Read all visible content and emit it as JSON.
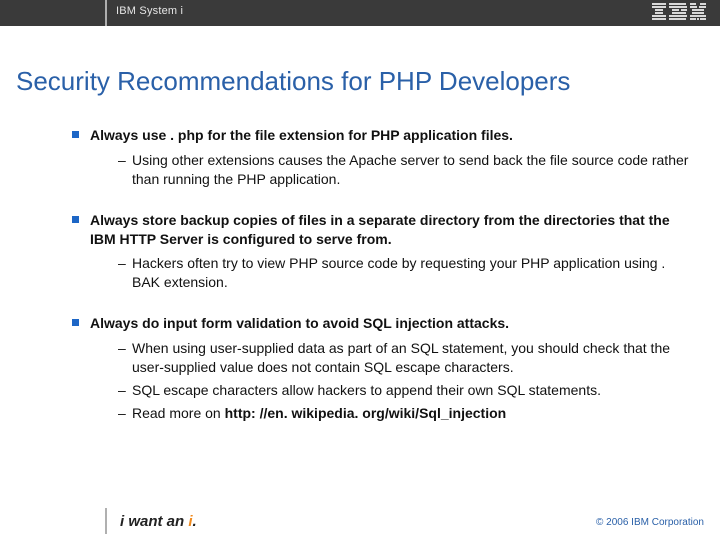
{
  "header": {
    "product": "IBM System i",
    "logo_alt": "IBM"
  },
  "title": "Security Recommendations for PHP Developers",
  "bullets": [
    {
      "lead": "Always use . php for the file extension for PHP application files.",
      "subs": [
        "Using other extensions causes the Apache server to send back the file source code rather than running the PHP application."
      ]
    },
    {
      "lead": "Always store backup copies of files in a separate directory from the directories that the IBM HTTP Server is configured to serve from.",
      "subs": [
        "Hackers often try to view PHP source code by requesting your PHP application using . BAK extension."
      ]
    },
    {
      "lead": "Always do input form validation to avoid SQL injection attacks.",
      "subs": [
        "When using user-supplied data as part of an SQL statement, you should check that the user-supplied value does not contain SQL escape characters.",
        "SQL escape characters allow hackers to append their own SQL statements.",
        "Read more on http: //en. wikipedia. org/wiki/Sql_injection"
      ]
    }
  ],
  "footer": {
    "tagline_prefix": "i want an ",
    "tagline_accent": "i",
    "tagline_suffix": ".",
    "copyright": "© 2006 IBM Corporation"
  }
}
